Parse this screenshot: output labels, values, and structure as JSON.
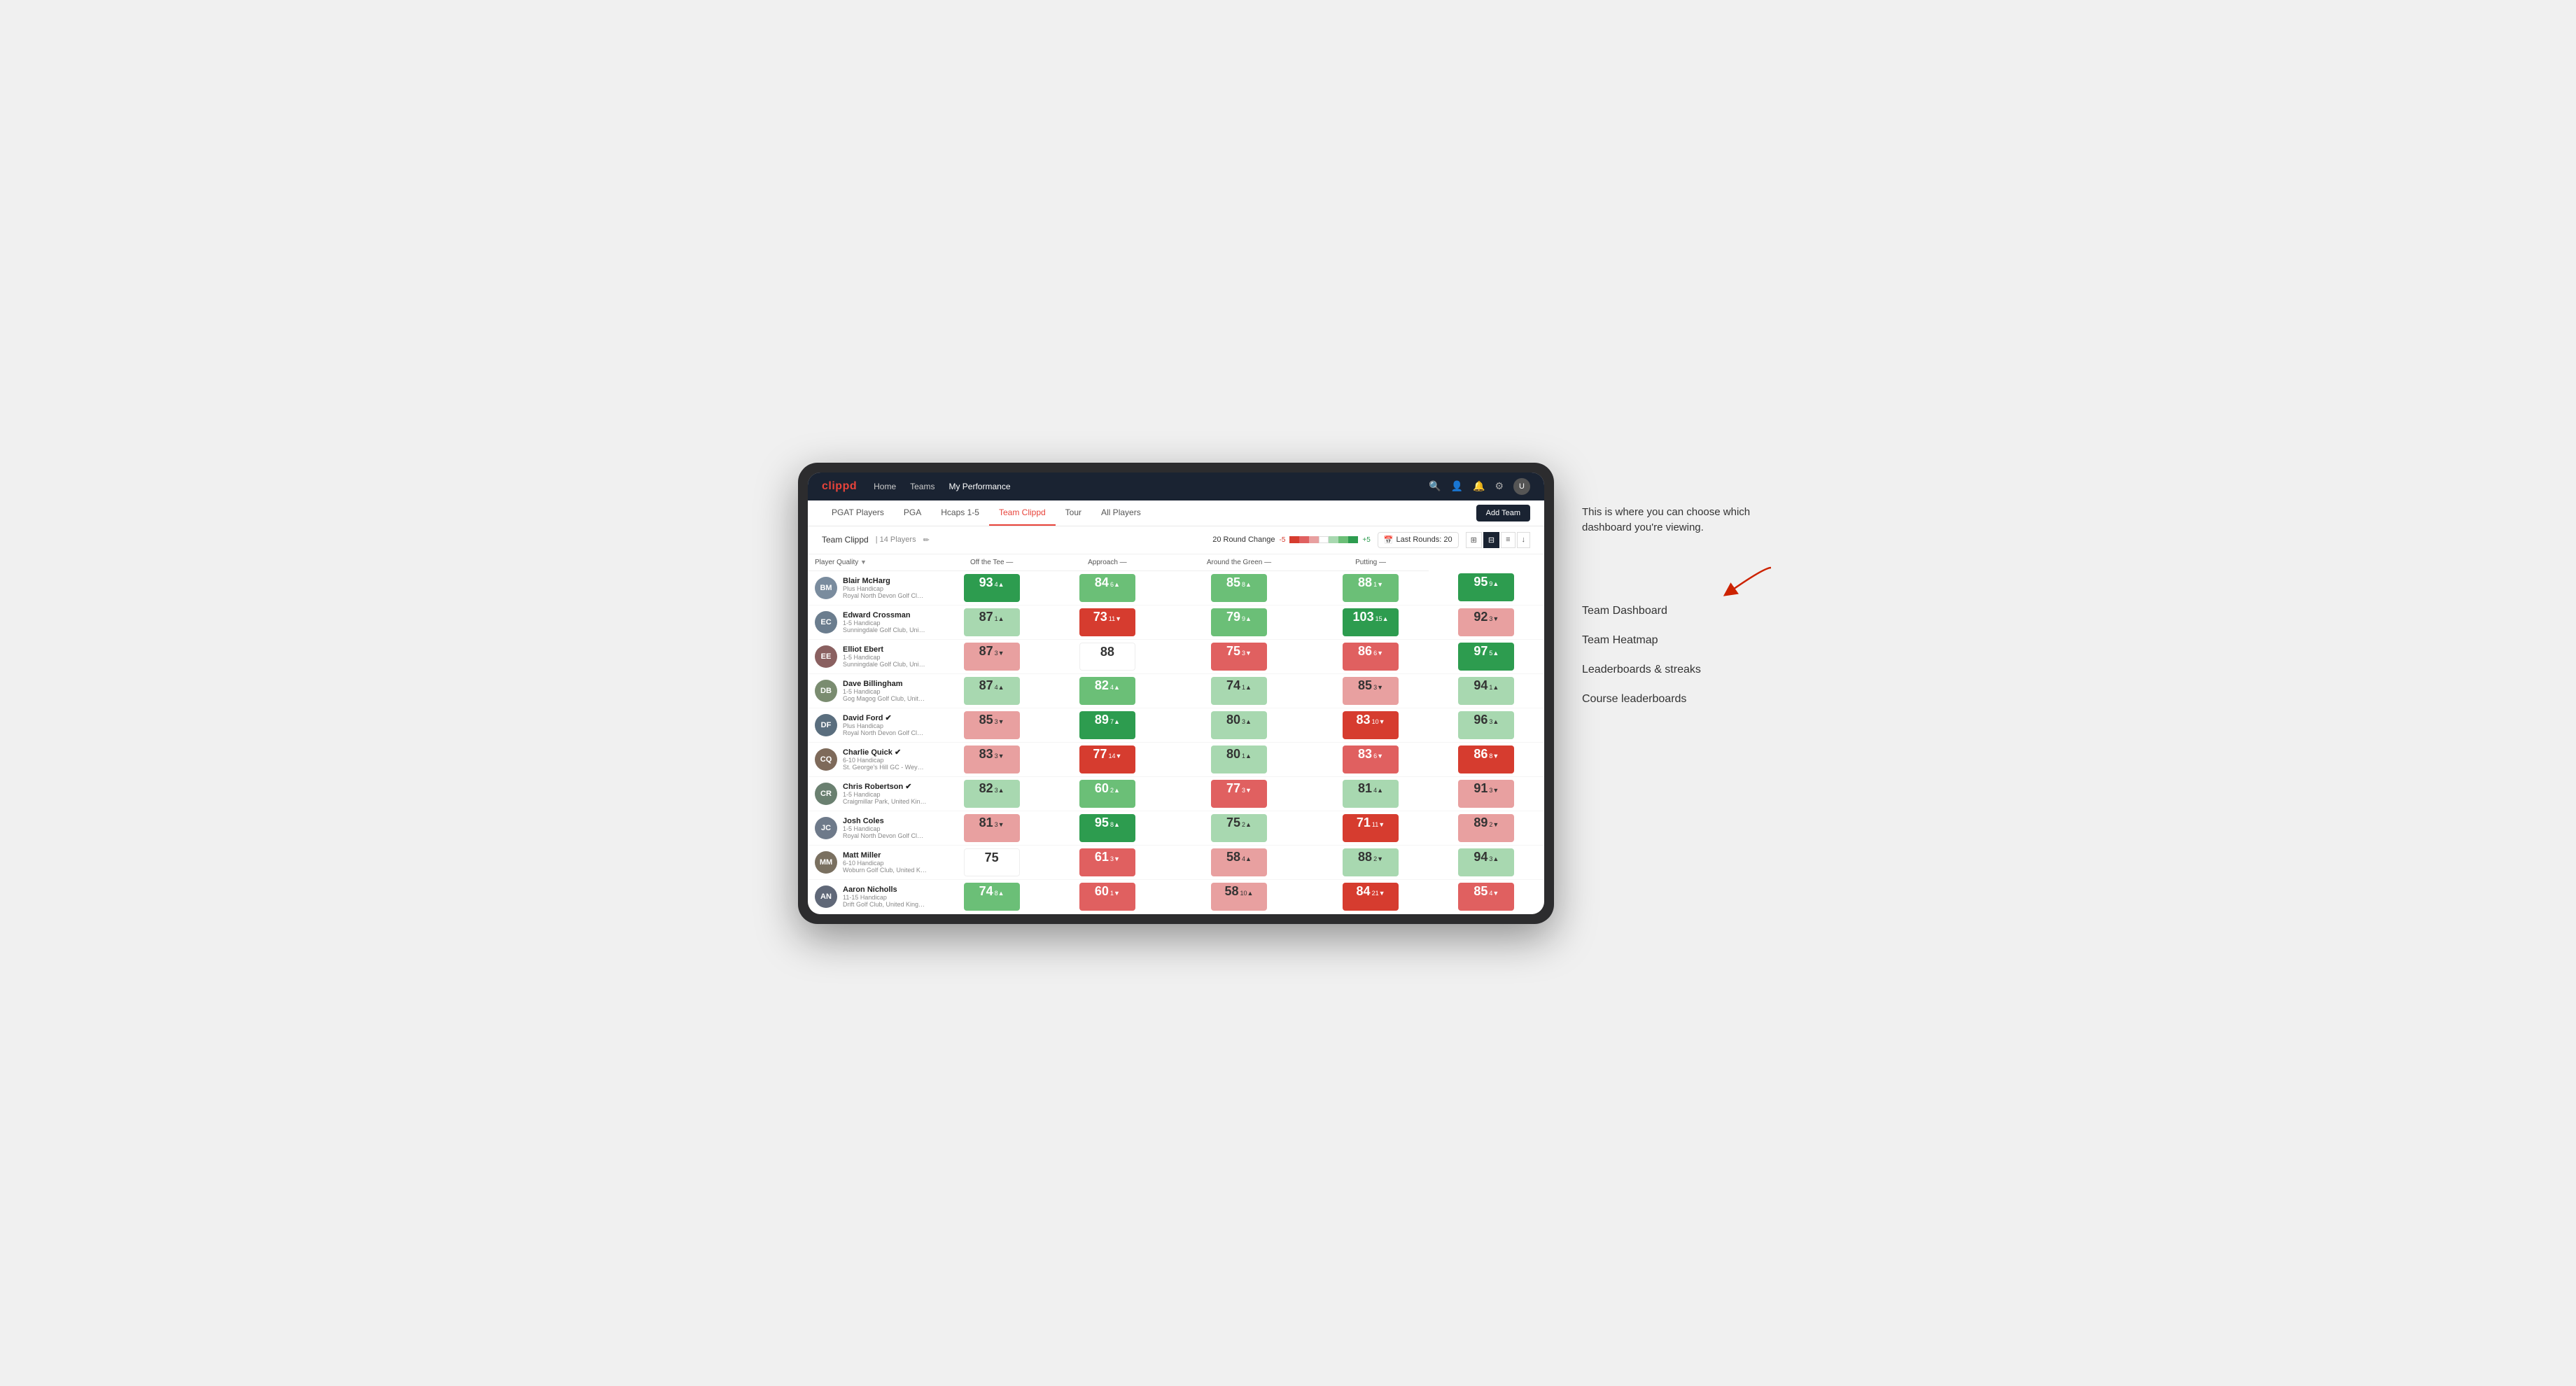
{
  "app": {
    "logo": "clippd",
    "nav": {
      "links": [
        {
          "label": "Home",
          "active": false
        },
        {
          "label": "Teams",
          "active": false
        },
        {
          "label": "My Performance",
          "active": true
        }
      ]
    },
    "sub_nav": {
      "links": [
        {
          "label": "PGAT Players",
          "active": false
        },
        {
          "label": "PGA",
          "active": false
        },
        {
          "label": "Hcaps 1-5",
          "active": false
        },
        {
          "label": "Team Clippd",
          "active": true
        },
        {
          "label": "Tour",
          "active": false
        },
        {
          "label": "All Players",
          "active": false
        }
      ],
      "add_team_label": "Add Team"
    },
    "team_bar": {
      "name": "Team Clippd",
      "separator": "|",
      "count": "14 Players",
      "round_change_label": "20 Round Change",
      "change_neg": "-5",
      "change_pos": "+5",
      "last_rounds_label": "Last Rounds:",
      "last_rounds_num": "20"
    },
    "table": {
      "headers": [
        {
          "label": "Player Quality",
          "arrow": "▼",
          "col": "player-quality"
        },
        {
          "label": "Off the Tee",
          "arrow": "—",
          "col": "off-tee"
        },
        {
          "label": "Approach",
          "arrow": "—",
          "col": "approach"
        },
        {
          "label": "Around the Green",
          "arrow": "—",
          "col": "around-green"
        },
        {
          "label": "Putting",
          "arrow": "—",
          "col": "putting"
        }
      ],
      "rows": [
        {
          "name": "Blair McHarg",
          "handicap": "Plus Handicap",
          "club": "Royal North Devon Golf Club, United Kingdom",
          "initials": "BM",
          "avatar_color": "#7a8c9e",
          "scores": [
            {
              "value": "93",
              "change": "4",
              "dir": "up",
              "color": "green-dark"
            },
            {
              "value": "84",
              "change": "6",
              "dir": "up",
              "color": "green-light"
            },
            {
              "value": "85",
              "change": "8",
              "dir": "up",
              "color": "green-light"
            },
            {
              "value": "88",
              "change": "1",
              "dir": "down",
              "color": "green-light"
            },
            {
              "value": "95",
              "change": "9",
              "dir": "up",
              "color": "green-dark"
            }
          ]
        },
        {
          "name": "Edward Crossman",
          "handicap": "1-5 Handicap",
          "club": "Sunningdale Golf Club, United Kingdom",
          "initials": "EC",
          "avatar_color": "#6b7d8e",
          "scores": [
            {
              "value": "87",
              "change": "1",
              "dir": "up",
              "color": "green-pale"
            },
            {
              "value": "73",
              "change": "11",
              "dir": "down",
              "color": "red-dark"
            },
            {
              "value": "79",
              "change": "9",
              "dir": "up",
              "color": "green-light"
            },
            {
              "value": "103",
              "change": "15",
              "dir": "up",
              "color": "green-dark"
            },
            {
              "value": "92",
              "change": "3",
              "dir": "down",
              "color": "red-light"
            }
          ]
        },
        {
          "name": "Elliot Ebert",
          "handicap": "1-5 Handicap",
          "club": "Sunningdale Golf Club, United Kingdom",
          "initials": "EE",
          "avatar_color": "#8a6060",
          "scores": [
            {
              "value": "87",
              "change": "3",
              "dir": "down",
              "color": "red-light"
            },
            {
              "value": "88",
              "change": "",
              "dir": "",
              "color": "white-cell"
            },
            {
              "value": "75",
              "change": "3",
              "dir": "down",
              "color": "red-medium"
            },
            {
              "value": "86",
              "change": "6",
              "dir": "down",
              "color": "red-medium"
            },
            {
              "value": "97",
              "change": "5",
              "dir": "up",
              "color": "green-dark"
            }
          ]
        },
        {
          "name": "Dave Billingham",
          "handicap": "1-5 Handicap",
          "club": "Gog Magog Golf Club, United Kingdom",
          "initials": "DB",
          "avatar_color": "#7a8c70",
          "scores": [
            {
              "value": "87",
              "change": "4",
              "dir": "up",
              "color": "green-pale"
            },
            {
              "value": "82",
              "change": "4",
              "dir": "up",
              "color": "green-light"
            },
            {
              "value": "74",
              "change": "1",
              "dir": "up",
              "color": "green-pale"
            },
            {
              "value": "85",
              "change": "3",
              "dir": "down",
              "color": "red-light"
            },
            {
              "value": "94",
              "change": "1",
              "dir": "up",
              "color": "green-pale"
            }
          ]
        },
        {
          "name": "David Ford",
          "handicap": "Plus Handicap",
          "club": "Royal North Devon Golf Club, United Kingdom",
          "initials": "DF",
          "avatar_color": "#5a6e7e",
          "verified": true,
          "scores": [
            {
              "value": "85",
              "change": "3",
              "dir": "down",
              "color": "red-light"
            },
            {
              "value": "89",
              "change": "7",
              "dir": "up",
              "color": "green-dark"
            },
            {
              "value": "80",
              "change": "3",
              "dir": "up",
              "color": "green-pale"
            },
            {
              "value": "83",
              "change": "10",
              "dir": "down",
              "color": "red-dark"
            },
            {
              "value": "96",
              "change": "3",
              "dir": "up",
              "color": "green-pale"
            }
          ]
        },
        {
          "name": "Charlie Quick",
          "handicap": "6-10 Handicap",
          "club": "St. George's Hill GC - Weybridge - Surrey, Uni...",
          "initials": "CQ",
          "avatar_color": "#7e6a5a",
          "verified": true,
          "scores": [
            {
              "value": "83",
              "change": "3",
              "dir": "down",
              "color": "red-light"
            },
            {
              "value": "77",
              "change": "14",
              "dir": "down",
              "color": "red-dark"
            },
            {
              "value": "80",
              "change": "1",
              "dir": "up",
              "color": "green-pale"
            },
            {
              "value": "83",
              "change": "6",
              "dir": "down",
              "color": "red-medium"
            },
            {
              "value": "86",
              "change": "8",
              "dir": "down",
              "color": "red-dark"
            }
          ]
        },
        {
          "name": "Chris Robertson",
          "handicap": "1-5 Handicap",
          "club": "Craigmillar Park, United Kingdom",
          "initials": "CR",
          "avatar_color": "#6a8070",
          "verified": true,
          "scores": [
            {
              "value": "82",
              "change": "3",
              "dir": "up",
              "color": "green-pale"
            },
            {
              "value": "60",
              "change": "2",
              "dir": "up",
              "color": "green-light"
            },
            {
              "value": "77",
              "change": "3",
              "dir": "down",
              "color": "red-medium"
            },
            {
              "value": "81",
              "change": "4",
              "dir": "up",
              "color": "green-pale"
            },
            {
              "value": "91",
              "change": "3",
              "dir": "down",
              "color": "red-light"
            }
          ]
        },
        {
          "name": "Josh Coles",
          "handicap": "1-5 Handicap",
          "club": "Royal North Devon Golf Club, United Kingdom",
          "initials": "JC",
          "avatar_color": "#6e7a8a",
          "scores": [
            {
              "value": "81",
              "change": "3",
              "dir": "down",
              "color": "red-light"
            },
            {
              "value": "95",
              "change": "8",
              "dir": "up",
              "color": "green-dark"
            },
            {
              "value": "75",
              "change": "2",
              "dir": "up",
              "color": "green-pale"
            },
            {
              "value": "71",
              "change": "11",
              "dir": "down",
              "color": "red-dark"
            },
            {
              "value": "89",
              "change": "2",
              "dir": "down",
              "color": "red-light"
            }
          ]
        },
        {
          "name": "Matt Miller",
          "handicap": "6-10 Handicap",
          "club": "Woburn Golf Club, United Kingdom",
          "initials": "MM",
          "avatar_color": "#7a7060",
          "scores": [
            {
              "value": "75",
              "change": "",
              "dir": "",
              "color": "white-cell"
            },
            {
              "value": "61",
              "change": "3",
              "dir": "down",
              "color": "red-medium"
            },
            {
              "value": "58",
              "change": "4",
              "dir": "up",
              "color": "red-light"
            },
            {
              "value": "88",
              "change": "2",
              "dir": "down",
              "color": "green-pale"
            },
            {
              "value": "94",
              "change": "3",
              "dir": "up",
              "color": "green-pale"
            }
          ]
        },
        {
          "name": "Aaron Nicholls",
          "handicap": "11-15 Handicap",
          "club": "Drift Golf Club, United Kingdom",
          "initials": "AN",
          "avatar_color": "#606878",
          "scores": [
            {
              "value": "74",
              "change": "8",
              "dir": "up",
              "color": "green-light"
            },
            {
              "value": "60",
              "change": "1",
              "dir": "down",
              "color": "red-medium"
            },
            {
              "value": "58",
              "change": "10",
              "dir": "up",
              "color": "red-light"
            },
            {
              "value": "84",
              "change": "21",
              "dir": "down",
              "color": "red-dark"
            },
            {
              "value": "85",
              "change": "4",
              "dir": "down",
              "color": "red-medium"
            }
          ]
        }
      ]
    }
  },
  "annotation": {
    "intro": "This is where you can choose which dashboard you're viewing.",
    "items": [
      "Team Dashboard",
      "Team Heatmap",
      "Leaderboards & streaks",
      "Course leaderboards"
    ]
  }
}
